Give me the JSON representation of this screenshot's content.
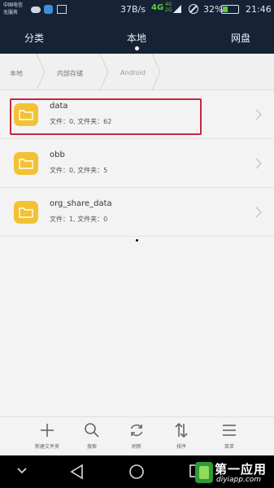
{
  "status_bar": {
    "carrier": "中国电信\n无服务",
    "speed": "37B/s",
    "network": "4G",
    "network2": "4G\n2G",
    "battery": "32%",
    "time": "21:46"
  },
  "tabs": [
    {
      "label": "分类"
    },
    {
      "label": "本地"
    },
    {
      "label": "网盘"
    }
  ],
  "breadcrumb": [
    "本地",
    "内部存储",
    "Android"
  ],
  "files": [
    {
      "name": "data",
      "meta": "文件：0, 文件夹：62"
    },
    {
      "name": "obb",
      "meta": "文件：0, 文件夹：5"
    },
    {
      "name": "org_share_data",
      "meta": "文件：1, 文件夹：0"
    }
  ],
  "toolbar": [
    {
      "label": "新建文件夹",
      "icon": "plus-icon"
    },
    {
      "label": "搜索",
      "icon": "search-icon"
    },
    {
      "label": "刷新",
      "icon": "refresh-icon"
    },
    {
      "label": "排序",
      "icon": "sort-icon"
    },
    {
      "label": "菜单",
      "icon": "menu-icon"
    }
  ],
  "watermark": {
    "title": "第一应用",
    "url": "diyiapp.com"
  },
  "colors": {
    "header_bg": "#162236",
    "folder": "#f2c232",
    "highlight": "#c4283f",
    "network": "#5fd13a"
  }
}
